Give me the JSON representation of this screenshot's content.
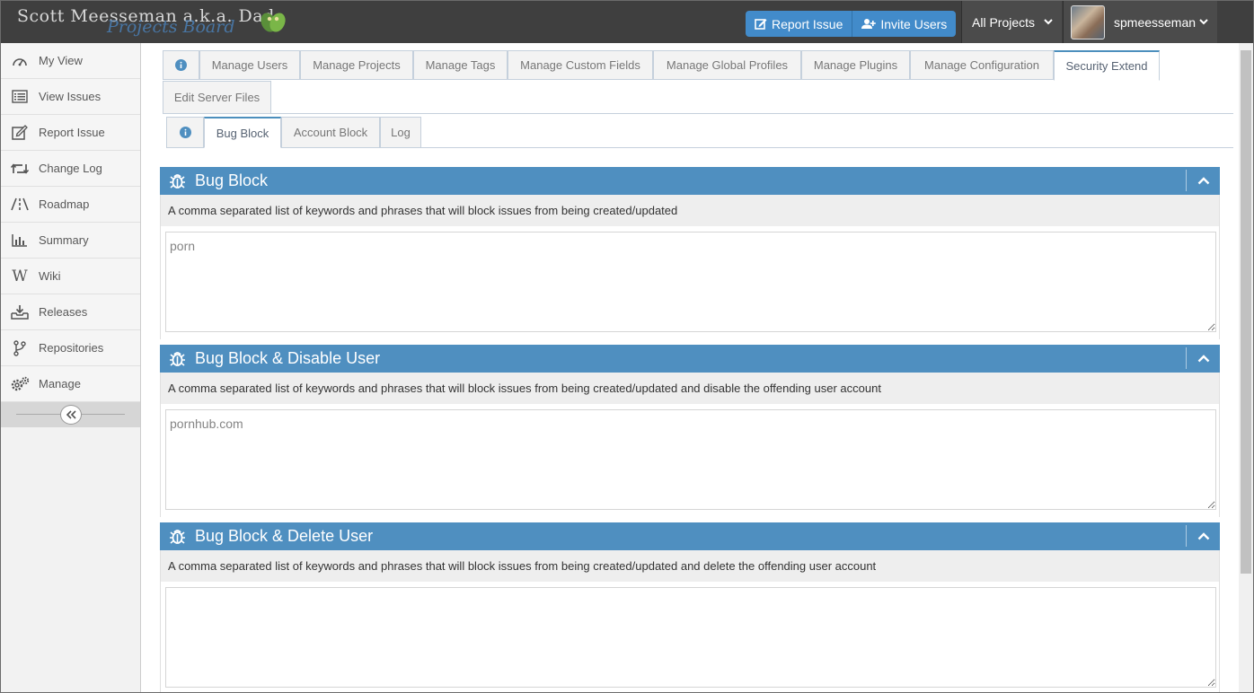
{
  "brand": {
    "title": "Scott Meesseman a.k.a. Dad",
    "subtitle": "Projects Board"
  },
  "navbar": {
    "report_issue": "Report Issue",
    "invite_users": "Invite Users",
    "projects": "All Projects",
    "username": "spmeesseman"
  },
  "sidebar": {
    "items": [
      {
        "label": "My View",
        "icon": "dashboard-icon"
      },
      {
        "label": "View Issues",
        "icon": "list-icon"
      },
      {
        "label": "Report Issue",
        "icon": "edit-icon"
      },
      {
        "label": "Change Log",
        "icon": "retweet-icon"
      },
      {
        "label": "Roadmap",
        "icon": "road-icon"
      },
      {
        "label": "Summary",
        "icon": "bar-chart-icon"
      },
      {
        "label": "Wiki",
        "icon": "wikipedia-icon"
      },
      {
        "label": "Releases",
        "icon": "download-tray-icon"
      },
      {
        "label": "Repositories",
        "icon": "code-fork-icon"
      },
      {
        "label": "Manage",
        "icon": "cogs-icon"
      }
    ]
  },
  "manage_tabs": [
    {
      "label": "Manage Users"
    },
    {
      "label": "Manage Projects"
    },
    {
      "label": "Manage Tags"
    },
    {
      "label": "Manage Custom Fields"
    },
    {
      "label": "Manage Global Profiles"
    },
    {
      "label": "Manage Plugins"
    },
    {
      "label": "Manage Configuration"
    },
    {
      "label": "Security Extend"
    },
    {
      "label": "Edit Server Files"
    }
  ],
  "active_manage_tab": "Security Extend",
  "sub_tabs": [
    {
      "label": "Bug Block"
    },
    {
      "label": "Account Block"
    },
    {
      "label": "Log"
    }
  ],
  "active_sub_tab": "Bug Block",
  "widgets": [
    {
      "title": "Bug Block",
      "description": "A comma separated list of keywords and phrases that will block issues from being created/updated",
      "value": "porn"
    },
    {
      "title": "Bug Block & Disable User",
      "description": "A comma separated list of keywords and phrases that will block issues from being created/updated and disable the offending user account",
      "value": "pornhub.com"
    },
    {
      "title": "Bug Block & Delete User",
      "description": "A comma separated list of keywords and phrases that will block issues from being created/updated and delete the offending user account",
      "value": ""
    }
  ],
  "colors": {
    "navbar": "#3f3f3f",
    "accent": "#428bca",
    "widget_header": "#4f8fc0"
  }
}
